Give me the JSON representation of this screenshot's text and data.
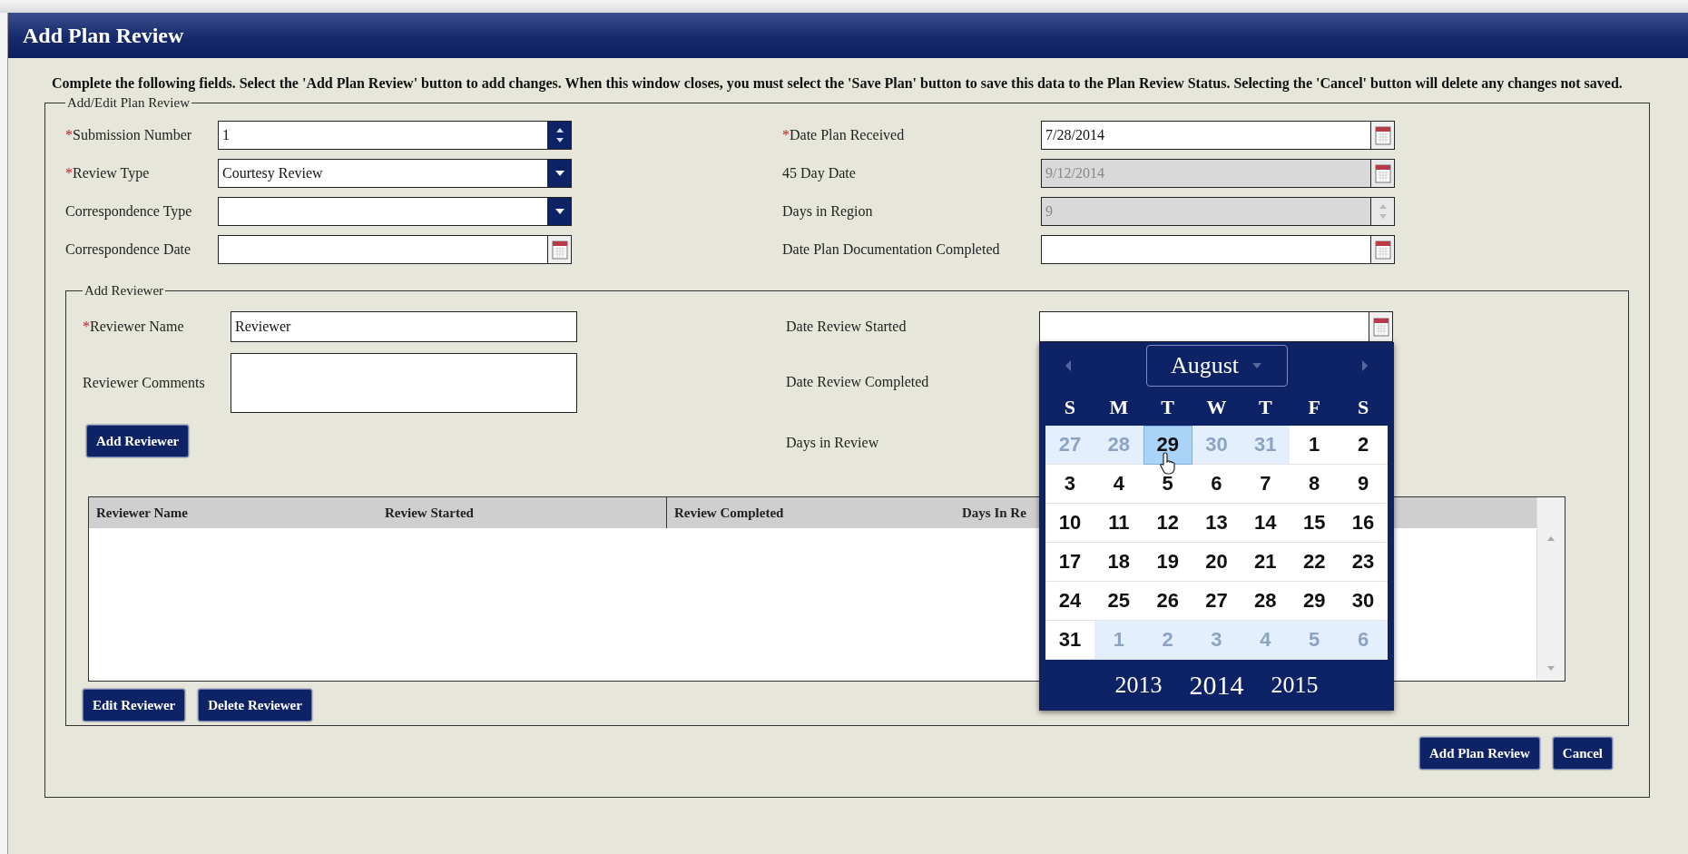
{
  "dialog": {
    "title": "Add Plan Review",
    "instructions": "Complete the following fields. Select the 'Add Plan Review' button to add changes. When this window closes, you must select the 'Save Plan' button to save this data to the Plan Review Status. Selecting the 'Cancel' button will delete any changes not saved."
  },
  "plan_review": {
    "legend": "Add/Edit Plan Review",
    "left_fields": [
      {
        "label": "Submission Number",
        "required_mark": "*",
        "kind": "spinner",
        "value": "1",
        "disabled": false
      },
      {
        "label": "Review Type",
        "required_mark": "*",
        "kind": "dropdown",
        "value": "Courtesy Review",
        "disabled": false
      },
      {
        "label": "Correspondence Type",
        "kind": "dropdown",
        "disabled": false
      },
      {
        "label": "Correspondence Date",
        "kind": "date",
        "disabled": false
      }
    ],
    "right_fields": [
      {
        "label": "Date Plan Received",
        "required_mark": "*",
        "kind": "date",
        "value": "7/28/2014",
        "disabled": false
      },
      {
        "label": "45 Day Date",
        "kind": "date",
        "value": "9/12/2014",
        "disabled": true
      },
      {
        "label": "Days in Region",
        "kind": "spinner",
        "value": "9",
        "disabled": true
      },
      {
        "label": "Date Plan Documentation Completed",
        "kind": "date",
        "disabled": false
      }
    ]
  },
  "reviewer": {
    "legend": "Add Reviewer",
    "left_fields": [
      {
        "label": "Reviewer Name",
        "required_mark": "*",
        "kind": "text",
        "value": "Reviewer"
      },
      {
        "label": "Reviewer Comments",
        "kind": "textarea"
      }
    ],
    "add_button": "Add Reviewer",
    "right_fields": [
      {
        "label": "Date Review Started",
        "kind": "date"
      },
      {
        "label": "Date Review Completed",
        "kind": "label"
      },
      {
        "label": "Days in Review",
        "kind": "label"
      }
    ],
    "table": {
      "columns": [
        "Reviewer Name",
        "Review Started",
        "Review Completed",
        "Days In Re"
      ]
    },
    "buttons": [
      "Edit Reviewer",
      "Delete Reviewer"
    ]
  },
  "calendar": {
    "month": "August",
    "weekdays": [
      "S",
      "M",
      "T",
      "W",
      "T",
      "F",
      "S"
    ],
    "weeks": [
      [
        {
          "day": "27",
          "muted": true,
          "selected": false
        },
        {
          "day": "28",
          "muted": true,
          "selected": false
        },
        {
          "day": "29",
          "muted": true,
          "selected": true
        },
        {
          "day": "30",
          "muted": true,
          "selected": false
        },
        {
          "day": "31",
          "muted": true,
          "selected": false
        },
        {
          "day": "1",
          "muted": false,
          "selected": false
        },
        {
          "day": "2",
          "muted": false,
          "selected": false
        }
      ],
      [
        {
          "day": "3",
          "muted": false,
          "selected": false
        },
        {
          "day": "4",
          "muted": false,
          "selected": false
        },
        {
          "day": "5",
          "muted": false,
          "selected": false
        },
        {
          "day": "6",
          "muted": false,
          "selected": false
        },
        {
          "day": "7",
          "muted": false,
          "selected": false
        },
        {
          "day": "8",
          "muted": false,
          "selected": false
        },
        {
          "day": "9",
          "muted": false,
          "selected": false
        }
      ],
      [
        {
          "day": "10",
          "muted": false,
          "selected": false
        },
        {
          "day": "11",
          "muted": false,
          "selected": false
        },
        {
          "day": "12",
          "muted": false,
          "selected": false
        },
        {
          "day": "13",
          "muted": false,
          "selected": false
        },
        {
          "day": "14",
          "muted": false,
          "selected": false
        },
        {
          "day": "15",
          "muted": false,
          "selected": false
        },
        {
          "day": "16",
          "muted": false,
          "selected": false
        }
      ],
      [
        {
          "day": "17",
          "muted": false,
          "selected": false
        },
        {
          "day": "18",
          "muted": false,
          "selected": false
        },
        {
          "day": "19",
          "muted": false,
          "selected": false
        },
        {
          "day": "20",
          "muted": false,
          "selected": false
        },
        {
          "day": "21",
          "muted": false,
          "selected": false
        },
        {
          "day": "22",
          "muted": false,
          "selected": false
        },
        {
          "day": "23",
          "muted": false,
          "selected": false
        }
      ],
      [
        {
          "day": "24",
          "muted": false,
          "selected": false
        },
        {
          "day": "25",
          "muted": false,
          "selected": false
        },
        {
          "day": "26",
          "muted": false,
          "selected": false
        },
        {
          "day": "27",
          "muted": false,
          "selected": false
        },
        {
          "day": "28",
          "muted": false,
          "selected": false
        },
        {
          "day": "29",
          "muted": false,
          "selected": false
        },
        {
          "day": "30",
          "muted": false,
          "selected": false
        }
      ],
      [
        {
          "day": "31",
          "muted": false,
          "selected": false
        },
        {
          "day": "1",
          "muted": true,
          "selected": false
        },
        {
          "day": "2",
          "muted": true,
          "selected": false
        },
        {
          "day": "3",
          "muted": true,
          "selected": false
        },
        {
          "day": "4",
          "muted": true,
          "selected": false
        },
        {
          "day": "5",
          "muted": true,
          "selected": false
        },
        {
          "day": "6",
          "muted": true,
          "selected": false
        }
      ]
    ],
    "years": [
      {
        "label": "2013",
        "selected": false
      },
      {
        "label": "2014",
        "selected": true
      },
      {
        "label": "2015",
        "selected": false
      }
    ]
  },
  "footer_buttons": [
    "Add Plan Review",
    "Cancel"
  ]
}
